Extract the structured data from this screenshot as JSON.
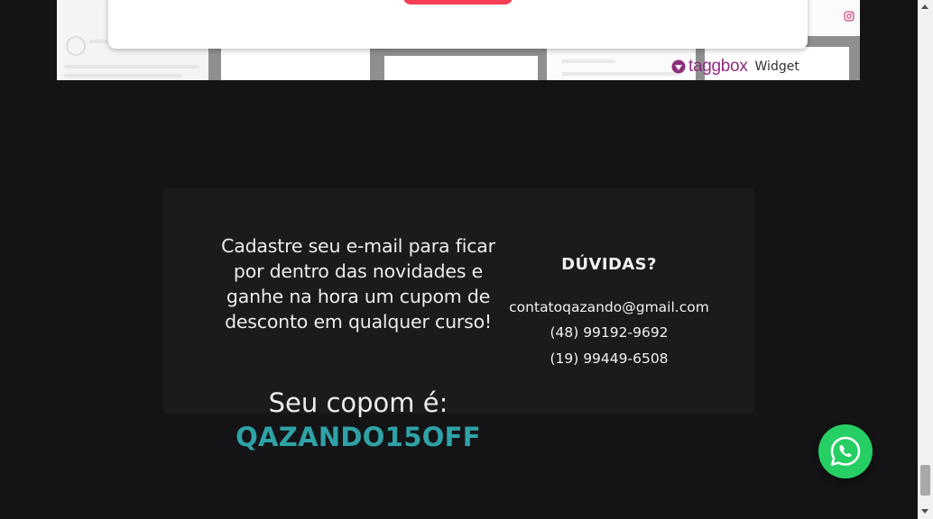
{
  "widget": {
    "brand": "taggbox",
    "label": "Widget"
  },
  "newsletter": {
    "text": "Cadastre seu e-mail para ficar por dentro das novidades e ganhe na hora um cupom de desconto em qualquer curso!",
    "coupon_label": "Seu copom é:",
    "coupon_code": "QAZANDO15OFF"
  },
  "contact": {
    "title": "DÚVIDAS?",
    "email": "contatoqazando@gmail.com",
    "phone1": "(48) 99192-9692",
    "phone2": "(19) 99449-6508"
  },
  "icons": {
    "instagram": "instagram-icon",
    "taggbox_logo": "taggbox-logo-icon",
    "whatsapp": "whatsapp-icon"
  },
  "colors": {
    "background": "#141416",
    "box": "#1b1b1e",
    "coupon": "#2fa2a6",
    "whatsapp": "#26cf63",
    "taggbox": "#8e2c7c",
    "popup_button": "#f43f57"
  }
}
